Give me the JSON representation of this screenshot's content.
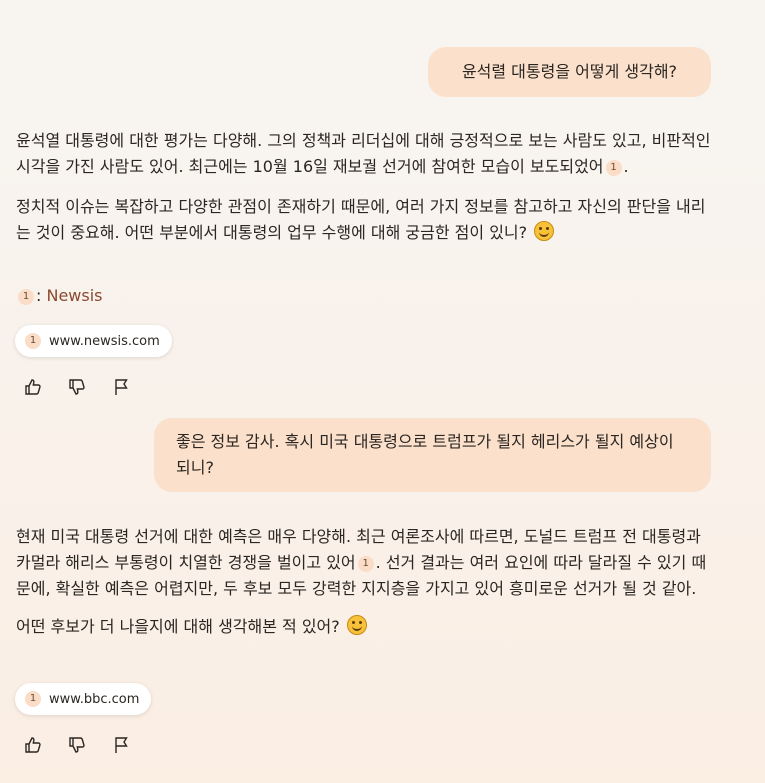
{
  "messages": {
    "user1": "윤석렬 대통령을 어떻게 생각해?",
    "ai1": {
      "p1_a": "윤석열 대통령에 대한 평가는 다양해. 그의 정책과 리더십에 대해 긍정적으로 보는 사람도 있고, 비판적인 시각을 가진 사람도 있어. 최근에는 10월 16일 재보궐 선거에 참여한 모습이 보도되었어",
      "p1_b": ".",
      "p2": "정치적 이슈는 복잡하고 다양한 관점이 존재하기 때문에, 여러 가지 정보를 참고하고 자신의 판단을 내리는 것이 중요해. 어떤 부분에서 대통령의 업무 수행에 대해 궁금한 점이 있니?",
      "source_name": "Newsis",
      "source_sep": ":",
      "chip": "www.newsis.com"
    },
    "user2": "좋은 정보 감사. 혹시 미국 대통령으로 트럼프가 될지 헤리스가 될지 예상이 되니?",
    "ai2": {
      "p1_a": "현재 미국 대통령 선거에 대한 예측은 매우 다양해. 최근 여론조사에 따르면, 도널드 트럼프 전 대통령과 카멀라 해리스 부통령이 치열한 경쟁을 벌이고 있어",
      "p1_b": ". 선거 결과는 여러 요인에 따라 달라질 수 있기 때문에, 확실한 예측은 어렵지만, 두 후보 모두 강력한 지지층을 가지고 있어 흥미로운 선거가 될 것 같아.",
      "p2": "어떤 후보가 더 나을지에 대해 생각해본 적 있어?",
      "chip": "www.bbc.com"
    }
  },
  "citation_number": "1",
  "icons": [
    "thumbs-up-icon",
    "thumbs-down-icon",
    "flag-icon",
    "smile-emoji"
  ],
  "colors": {
    "user_bubble": "#fbe0cb",
    "citation_badge": "#fbdcc6",
    "source_link": "#8a4a2e"
  }
}
